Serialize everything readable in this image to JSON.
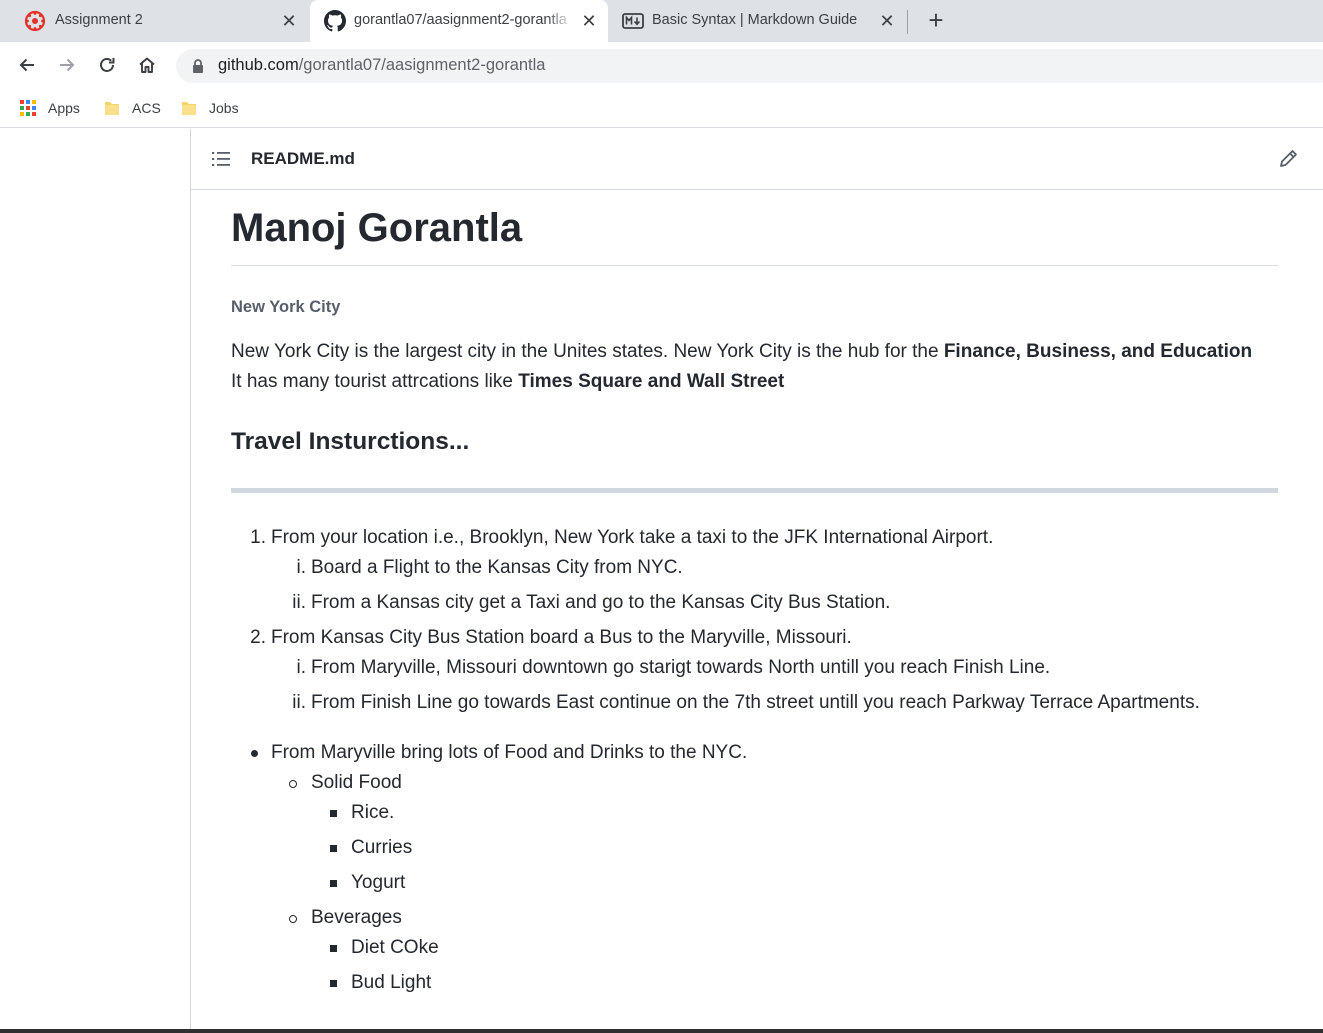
{
  "browser": {
    "tabs": [
      {
        "title": "Assignment 2",
        "favicon": "canvas-lms-icon"
      },
      {
        "title": "gorantla07/aasignment2-gorantla",
        "favicon": "github-icon",
        "active": true
      },
      {
        "title": "Basic Syntax | Markdown Guide",
        "favicon": "markdown-icon"
      }
    ],
    "close_glyph": "✕",
    "new_tab_glyph": "+",
    "url_host": "github.com",
    "url_path": "/gorantla07/aasignment2-gorantla",
    "bookmarks": [
      {
        "label": "Apps",
        "icon": "apps-grid-icon"
      },
      {
        "label": "ACS",
        "icon": "folder-icon"
      },
      {
        "label": "Jobs",
        "icon": "folder-icon"
      }
    ]
  },
  "readme": {
    "filename": "README.md",
    "h1": "Manoj Gorantla",
    "h6": "New York City",
    "para": {
      "t1": "New York City is the largest city in the Unites states. New York City is the hub for the ",
      "b1": "Finance, Business, and Education",
      "t2": "It has many tourist attrcations like ",
      "b2": "Times Square and Wall Street"
    },
    "h3": "Travel Insturctions...",
    "ordered": [
      {
        "marker": "1.",
        "text": "From your location i.e., Brooklyn, New York take a taxi to the JFK International Airport.",
        "sub": [
          {
            "marker": "i.",
            "text": "Board a Flight to the Kansas City from NYC."
          },
          {
            "marker": "ii.",
            "text": "From a Kansas city get a Taxi and go to the Kansas City Bus Station."
          }
        ]
      },
      {
        "marker": "2.",
        "text": "From Kansas City Bus Station board a Bus to the Maryville, Missouri.",
        "sub": [
          {
            "marker": "i.",
            "text": "From Maryville, Missouri downtown go starigt towards North untill you reach Finish Line."
          },
          {
            "marker": "ii.",
            "text": "From Finish Line go towards East continue on the 7th street untill you reach Parkway Terrace Apartments."
          }
        ]
      }
    ],
    "unordered": {
      "text": "From Maryville bring lots of Food and Drinks to the NYC.",
      "groups": [
        {
          "text": "Solid Food",
          "items": [
            "Rice.",
            "Curries",
            "Yogurt"
          ]
        },
        {
          "text": "Beverages",
          "items": [
            "Diet COke",
            "Bud Light"
          ]
        }
      ]
    }
  },
  "colors": {
    "text": "#24292f",
    "muted": "#57606a",
    "border": "#d0d7de",
    "tabstrip": "#dee1e6"
  }
}
